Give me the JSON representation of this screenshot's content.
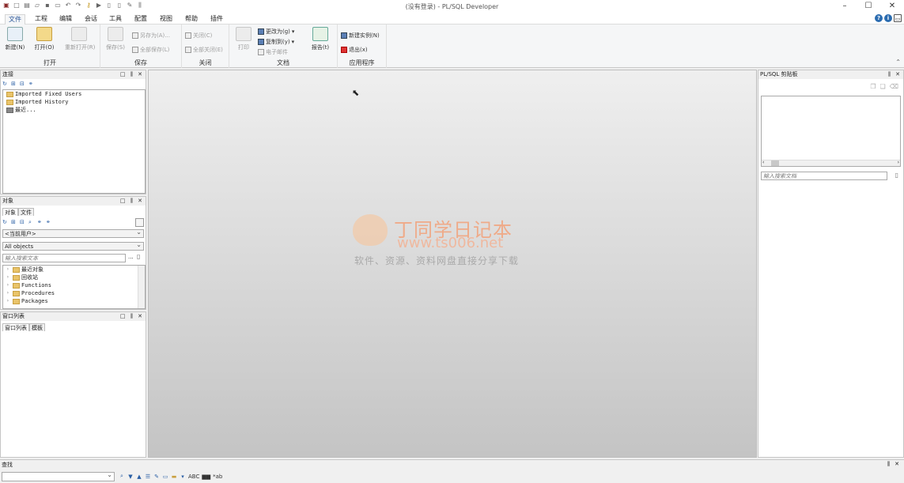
{
  "window": {
    "title": "(没有登录) - PL/SQL Developer"
  },
  "tabs": [
    {
      "label": "文件",
      "active": true
    },
    {
      "label": "工程"
    },
    {
      "label": "编辑"
    },
    {
      "label": "会话"
    },
    {
      "label": "工具"
    },
    {
      "label": "配置"
    },
    {
      "label": "视图"
    },
    {
      "label": "帮助"
    },
    {
      "label": "插件"
    }
  ],
  "ribbon": {
    "open_group": {
      "label": "打开",
      "new": "新建(N)",
      "open": "打开(O)",
      "reopen": "重新打开(R)"
    },
    "save_group": {
      "label": "保存",
      "save": "保存(S)",
      "save_as": "另存为(A)...",
      "save_all": "全部保存(L)"
    },
    "close_group": {
      "label": "关闭",
      "close": "关闭(C)",
      "close_all": "全部关闭(E)"
    },
    "doc_group": {
      "label": "文档",
      "print": "打印",
      "change_to": "更改为(g)",
      "copy_to": "复制到(y)",
      "email": "电子邮件",
      "report": "报告(t)"
    },
    "app_group": {
      "label": "应用程序",
      "new_instance": "新建实例(N)",
      "exit": "退出(x)"
    }
  },
  "connections": {
    "title": "连接",
    "items": [
      "Imported Fixed Users",
      "Imported History",
      "最近..."
    ]
  },
  "objects": {
    "title": "对象",
    "tabs": [
      "对象",
      "文件"
    ],
    "user_select": "<当前用户>",
    "filter_select": "All objects",
    "search_placeholder": "输入搜索文本",
    "items": [
      "最近对象",
      "回收站",
      "Functions",
      "Procedures",
      "Packages"
    ]
  },
  "window_list": {
    "title": "窗口列表",
    "tabs": [
      "窗口列表",
      "模板"
    ]
  },
  "clipboard": {
    "title": "PL/SQL 剪贴板",
    "search_placeholder": "输入搜索文档"
  },
  "watermark": {
    "line1": "丁同学日记本",
    "line2": "www.ts006.net",
    "line3": "软件、资源、资料网盘直接分享下载"
  },
  "find": {
    "title": "查找"
  }
}
